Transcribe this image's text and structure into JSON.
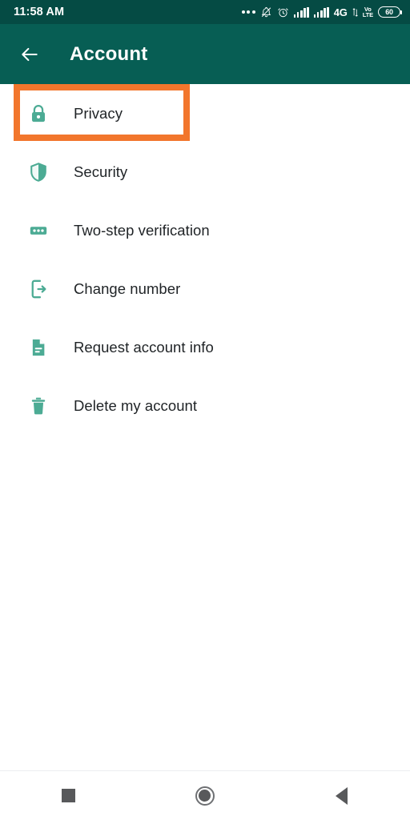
{
  "status_bar": {
    "time": "11:58 AM",
    "icons": [
      {
        "name": "more-dots-icon",
        "label": "..."
      },
      {
        "name": "bell-muted-icon",
        "label": "notifications-silenced"
      },
      {
        "name": "alarm-clock-icon",
        "label": "alarm"
      },
      {
        "name": "signal-bars-sim1-icon",
        "label": "signal"
      },
      {
        "name": "signal-bars-sim2-icon",
        "label": "signal"
      }
    ],
    "network_label": "4G",
    "volte_top": "VoLTE",
    "volte_line1": "Vo",
    "volte_line2": "LTE",
    "battery_level": "60",
    "background_color": "#054b44"
  },
  "app_bar": {
    "back_icon": "back-arrow-icon",
    "title": "Account",
    "background_color": "#075e54",
    "text_color": "#ffffff"
  },
  "list": {
    "items": [
      {
        "label": "Privacy",
        "icon": "lock-icon",
        "highlighted": true
      },
      {
        "label": "Security",
        "icon": "shield-icon",
        "highlighted": false
      },
      {
        "label": "Two-step verification",
        "icon": "dots-badge-icon",
        "highlighted": false
      },
      {
        "label": "Change number",
        "icon": "phone-exit-icon",
        "highlighted": false
      },
      {
        "label": "Request account info",
        "icon": "document-icon",
        "highlighted": false
      },
      {
        "label": "Delete my account",
        "icon": "trash-icon",
        "highlighted": false
      }
    ],
    "icon_color": "#4cab94",
    "text_color": "#1f2326",
    "background_color": "#ffffff"
  },
  "highlight": {
    "target": "Privacy",
    "color": "#f2762c",
    "border_width_px": 8
  },
  "nav_bar": {
    "buttons": [
      {
        "name": "recents-button",
        "icon": "square-icon"
      },
      {
        "name": "home-button",
        "icon": "circle-icon"
      },
      {
        "name": "back-button",
        "icon": "triangle-left-icon"
      }
    ],
    "icon_color": "#58595b",
    "background_color": "#ffffff"
  }
}
